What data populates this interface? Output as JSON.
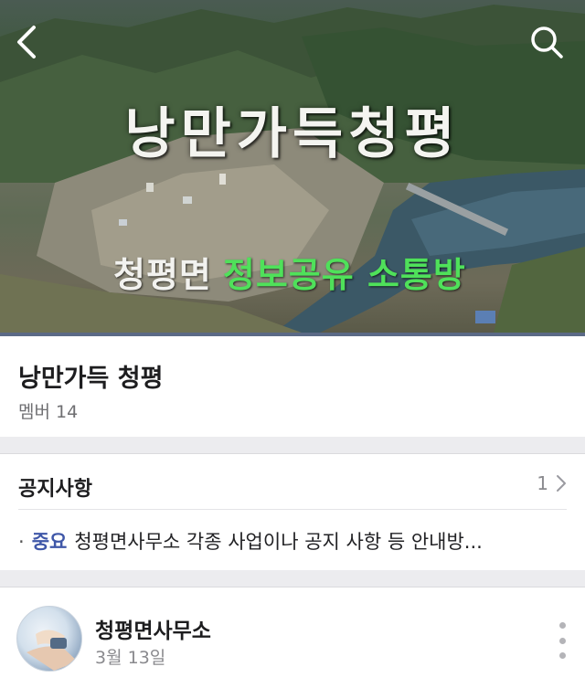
{
  "cover": {
    "title": "낭만가득청평",
    "subtitle_white": "청평면",
    "subtitle_green": "정보공유 소통방"
  },
  "nav": {
    "back_icon": "chevron-left-icon",
    "search_icon": "search-icon"
  },
  "group": {
    "name": "낭만가득 청평",
    "member_label": "멤버",
    "member_count": "14"
  },
  "notice": {
    "title": "공지사항",
    "count": "1",
    "bullet": "·",
    "item_badge": "중요",
    "item_text": "청평면사무소 각종 사업이나 공지 사항 등 안내방..."
  },
  "post": {
    "author": "청평면사무소",
    "date": "3월 13일"
  },
  "colors": {
    "accent_blue": "#3f57a8",
    "subtitle_green": "#4fe15a",
    "divider_bar": "#5b6a86"
  }
}
